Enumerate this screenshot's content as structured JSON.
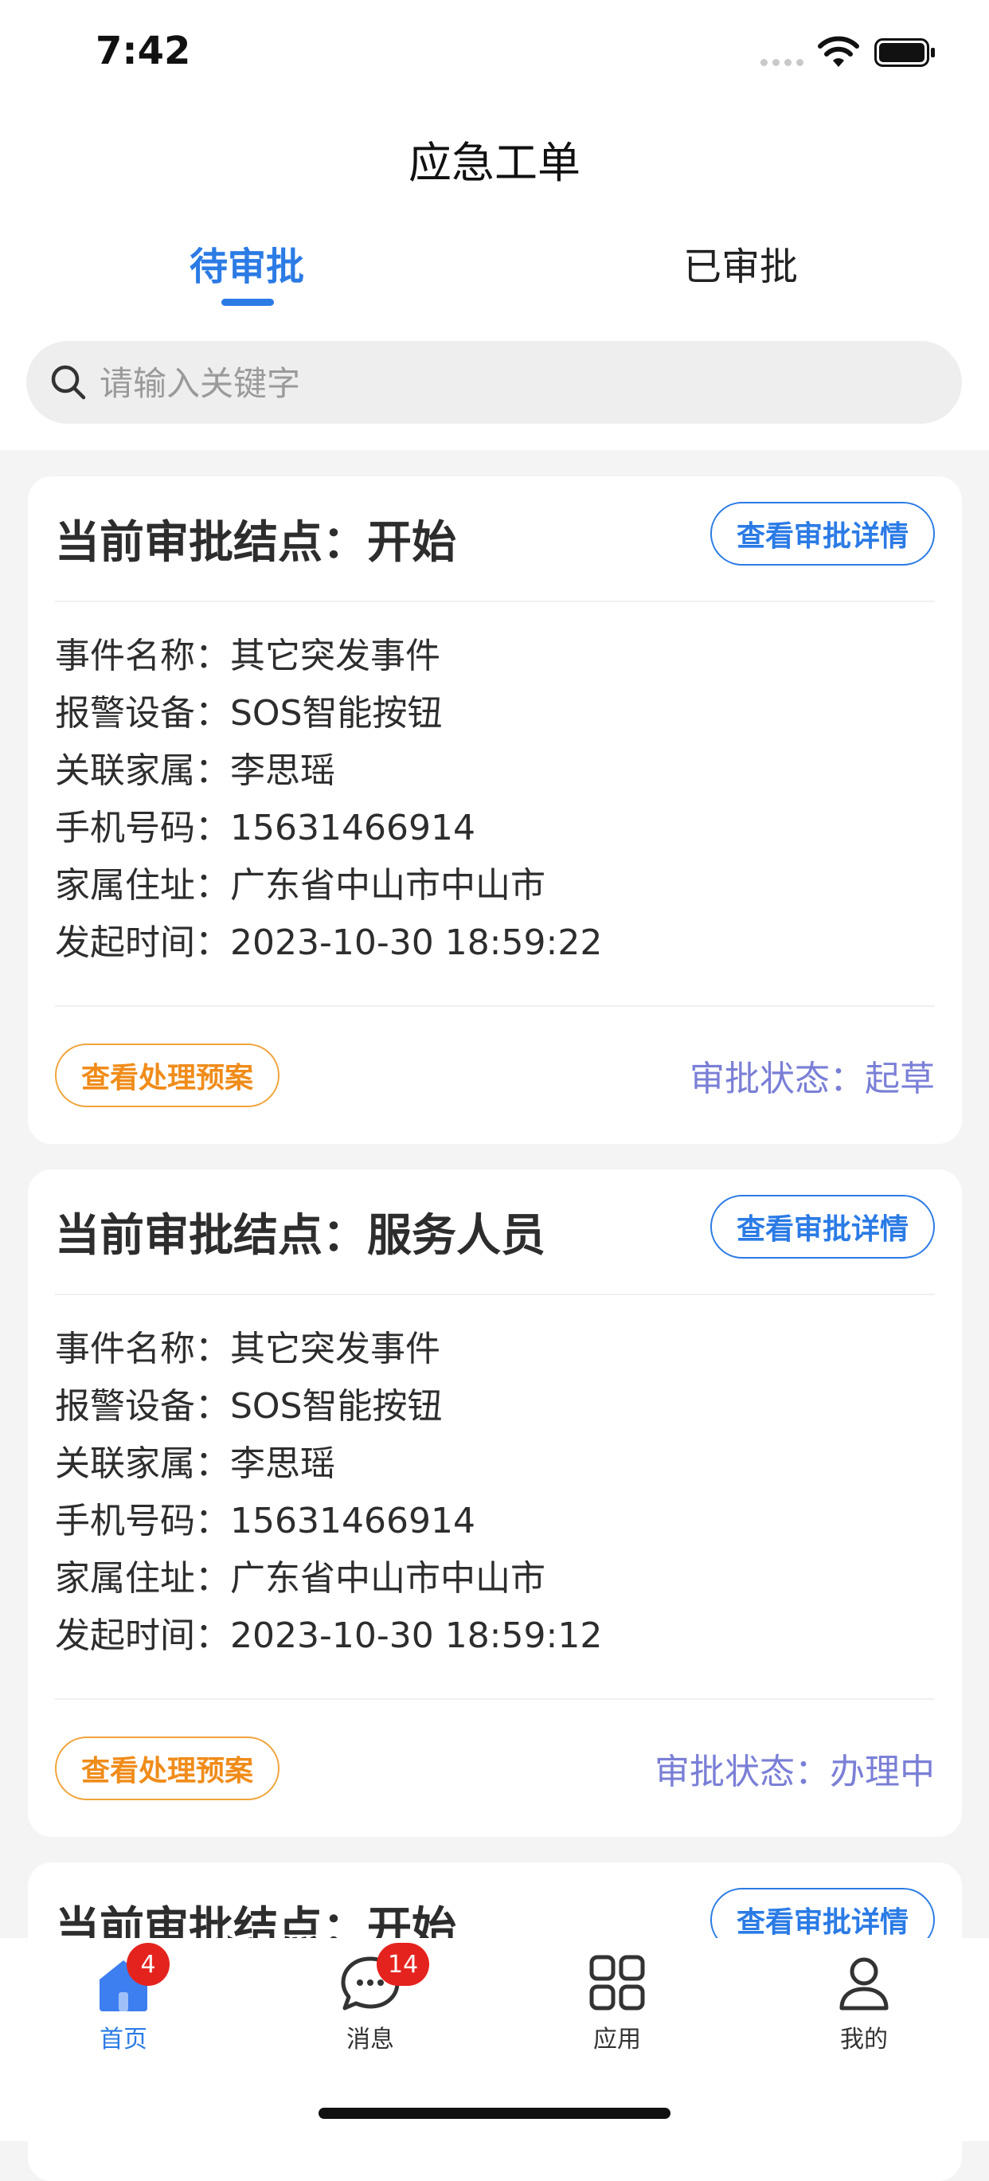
{
  "status_bar": {
    "time": "7:42"
  },
  "nav": {
    "title": "应急工单"
  },
  "tabs": [
    {
      "label": "待审批"
    },
    {
      "label": "已审批"
    }
  ],
  "search": {
    "placeholder": "请输入关键字"
  },
  "labels": {
    "event_name": "事件名称：",
    "device": "报警设备：",
    "family": "关联家属：",
    "phone": "手机号码：",
    "address": "家属住址：",
    "time": "发起时间：",
    "detail_button": "查看审批详情",
    "plan_button": "查看处理预案",
    "state_prefix": "审批状态："
  },
  "cards": [
    {
      "node": "当前审批结点：开始",
      "event_name": "其它突发事件",
      "device": "SOS智能按钮",
      "family": "李思瑶",
      "phone": "15631466914",
      "address": "广东省中山市中山市",
      "time": "2023-10-30 18:59:22",
      "state": "起草"
    },
    {
      "node": "当前审批结点：服务人员",
      "event_name": "其它突发事件",
      "device": "SOS智能按钮",
      "family": "李思瑶",
      "phone": "15631466914",
      "address": "广东省中山市中山市",
      "time": "2023-10-30 18:59:12",
      "state": "办理中"
    },
    {
      "node": "当前审批结点：开始"
    }
  ],
  "tabbar": {
    "items": [
      {
        "label": "首页",
        "icon": "home-icon",
        "badge": "4"
      },
      {
        "label": "消息",
        "icon": "message-icon",
        "badge": "14"
      },
      {
        "label": "应用",
        "icon": "apps-icon"
      },
      {
        "label": "我的",
        "icon": "user-icon"
      }
    ]
  },
  "colors": {
    "accent": "#2b7be5",
    "plan": "#f08c1a",
    "state": "#7a7fd6",
    "badge": "#e5231e"
  }
}
